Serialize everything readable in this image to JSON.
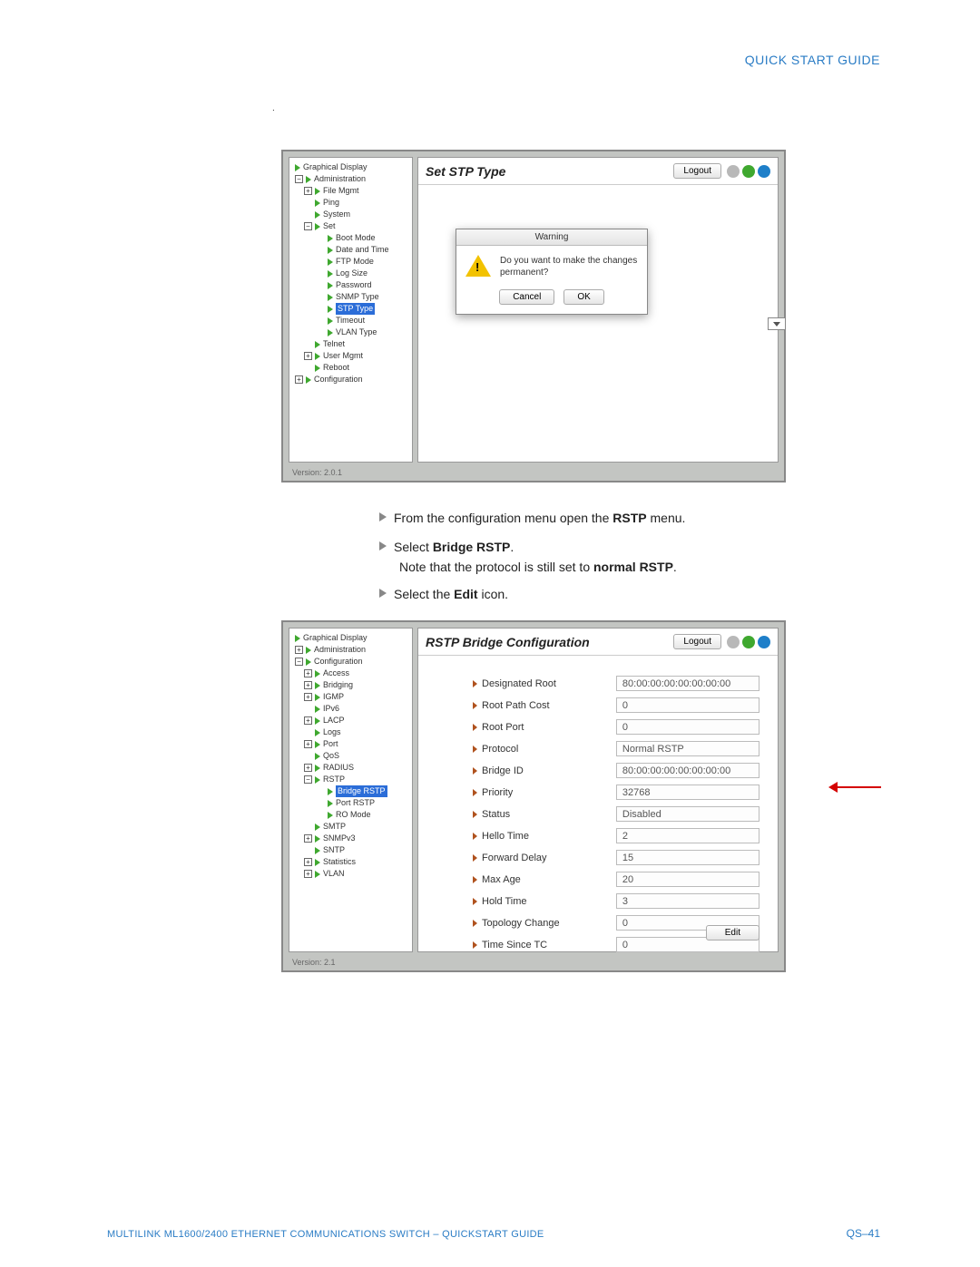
{
  "header": {
    "title": "QUICK START GUIDE"
  },
  "shot1": {
    "panelTitle": "Set STP Type",
    "logout": "Logout",
    "version": "Version: 2.0.1",
    "dialog": {
      "title": "Warning",
      "msg": "Do you want to make the changes  permanent?",
      "cancel": "Cancel",
      "ok": "OK"
    },
    "tree": {
      "graphical": "Graphical Display",
      "admin": "Administration",
      "fileMgmt": "File Mgmt",
      "ping": "Ping",
      "system": "System",
      "set": "Set",
      "bootMode": "Boot Mode",
      "dateTime": "Date and Time",
      "ftpMode": "FTP Mode",
      "logSize": "Log Size",
      "password": "Password",
      "snmpType": "SNMP Type",
      "stpType": "STP Type",
      "timeout": "Timeout",
      "vlanType": "VLAN Type",
      "telnet": "Telnet",
      "userMgmt": "User Mgmt",
      "reboot": "Reboot",
      "configuration": "Configuration"
    }
  },
  "instr": {
    "line1a": "From the configuration menu open the ",
    "line1b": "RSTP",
    "line1c": " menu.",
    "line2a": "Select ",
    "line2b": "Bridge RSTP",
    "line2c": ".",
    "line3a": "Note that the protocol is still set to ",
    "line3b": "normal RSTP",
    "line3c": ".",
    "line4a": "Select the ",
    "line4b": "Edit",
    "line4c": " icon."
  },
  "shot2": {
    "panelTitle": "RSTP Bridge Configuration",
    "logout": "Logout",
    "version": "Version: 2.1",
    "edit": "Edit",
    "tree": {
      "graphical": "Graphical Display",
      "admin": "Administration",
      "configuration": "Configuration",
      "access": "Access",
      "bridging": "Bridging",
      "igmp": "IGMP",
      "ipv6": "IPv6",
      "lacp": "LACP",
      "logs": "Logs",
      "port": "Port",
      "qos": "QoS",
      "radius": "RADIUS",
      "rstp": "RSTP",
      "bridgeRstp": "Bridge RSTP",
      "portRstp": "Port RSTP",
      "roMode": "RO Mode",
      "smtp": "SMTP",
      "snmpv3": "SNMPv3",
      "sntp": "SNTP",
      "statistics": "Statistics",
      "vlan": "VLAN"
    },
    "fields": {
      "designatedRoot": {
        "label": "Designated Root",
        "value": "80:00:00:00:00:00:00:00"
      },
      "rootPathCost": {
        "label": "Root Path Cost",
        "value": "0"
      },
      "rootPort": {
        "label": "Root Port",
        "value": "0"
      },
      "protocol": {
        "label": "Protocol",
        "value": "Normal RSTP"
      },
      "bridgeId": {
        "label": "Bridge ID",
        "value": "80:00:00:00:00:00:00:00"
      },
      "priority": {
        "label": "Priority",
        "value": "32768"
      },
      "status": {
        "label": "Status",
        "value": "Disabled"
      },
      "helloTime": {
        "label": "Hello Time",
        "value": "2"
      },
      "forwardDelay": {
        "label": "Forward Delay",
        "value": "15"
      },
      "maxAge": {
        "label": "Max Age",
        "value": "20"
      },
      "holdTime": {
        "label": "Hold Time",
        "value": "3"
      },
      "topologyChange": {
        "label": "Topology Change",
        "value": "0"
      },
      "timeSinceTc": {
        "label": "Time Since TC",
        "value": "0"
      }
    }
  },
  "footer": {
    "left": "MULTILINK ML1600/2400 ETHERNET COMMUNICATIONS SWITCH – QUICKSTART GUIDE",
    "right": "QS–41"
  }
}
